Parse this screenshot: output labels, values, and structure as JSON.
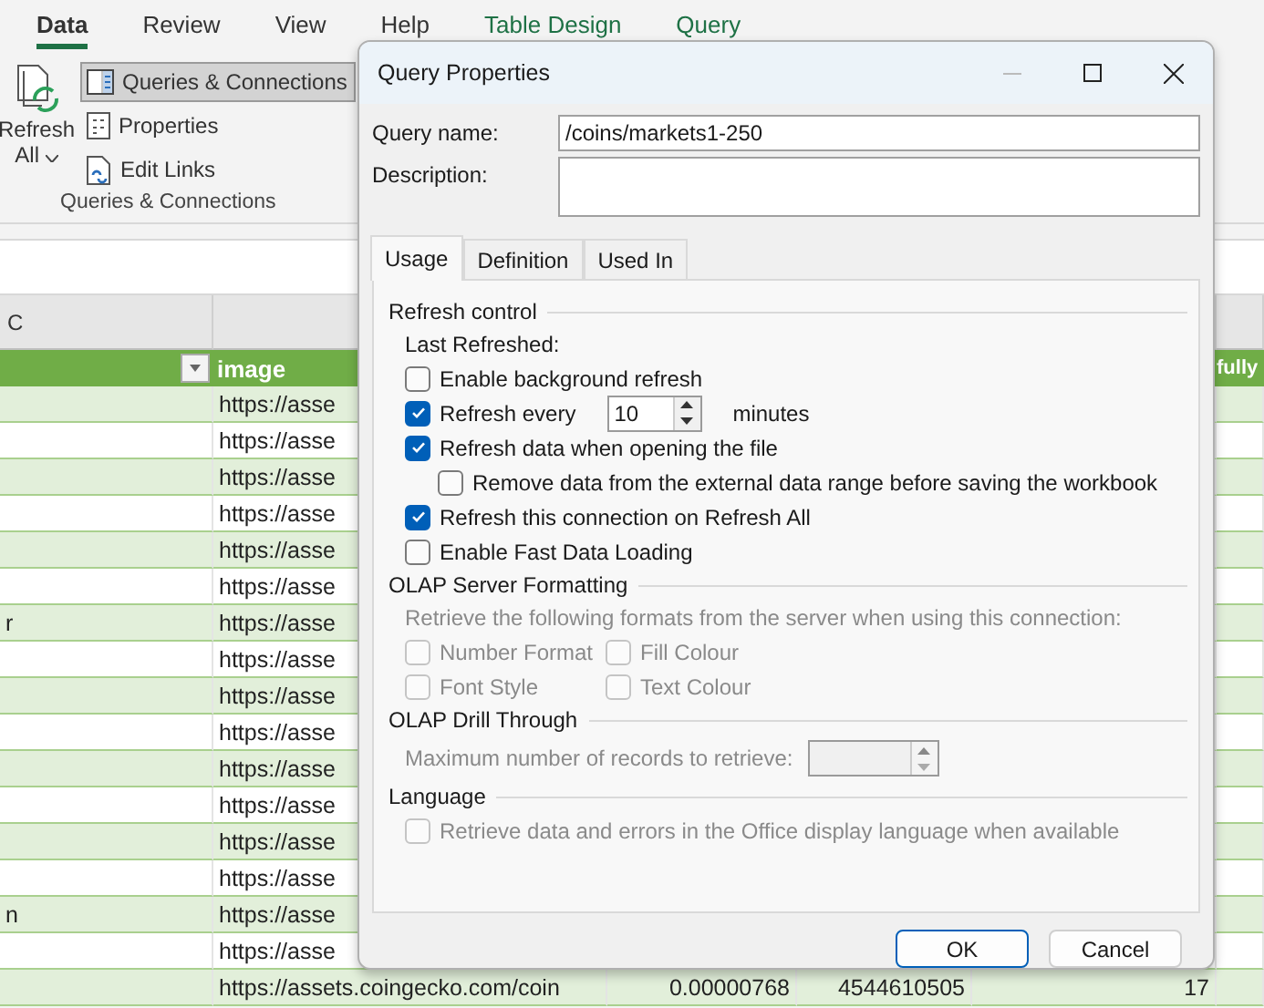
{
  "ribbon": {
    "tabs": [
      {
        "label": "Data",
        "selected": true,
        "contextual": false
      },
      {
        "label": "Review",
        "selected": false,
        "contextual": false
      },
      {
        "label": "View",
        "selected": false,
        "contextual": false
      },
      {
        "label": "Help",
        "selected": false,
        "contextual": false
      },
      {
        "label": "Table Design",
        "selected": false,
        "contextual": true
      },
      {
        "label": "Query",
        "selected": false,
        "contextual": true
      }
    ],
    "refresh_all": {
      "label": "Refresh",
      "caret_label": "All"
    },
    "commands": [
      {
        "label": "Queries & Connections",
        "selected": true
      },
      {
        "label": "Properties",
        "selected": false
      },
      {
        "label": "Edit Links",
        "selected": false
      }
    ],
    "group_label": "Queries & Connections"
  },
  "sheet": {
    "column_letters": {
      "column_1": "C"
    },
    "headers": {
      "column_2": "image",
      "column_6": "fully"
    },
    "rows": [
      {
        "image": "https://asse"
      },
      {
        "image": "https://asse"
      },
      {
        "image": "https://asse"
      },
      {
        "image": "https://asse"
      },
      {
        "image": "https://asse"
      },
      {
        "image": "https://asse"
      },
      {
        "column_1": "r",
        "image": "https://asse"
      },
      {
        "image": "https://asse"
      },
      {
        "image": "https://asse"
      },
      {
        "image": "https://asse"
      },
      {
        "image": "https://asse"
      },
      {
        "image": "https://asse"
      },
      {
        "image": "https://asse"
      },
      {
        "image": "https://asse"
      },
      {
        "column_1": "n",
        "image": "https://asse"
      },
      {
        "image": "https://asse"
      },
      {
        "image": "https://assets.coingecko.com/coin",
        "column_3": "0.00000768",
        "column_4": "4544610505",
        "column_5": "17"
      }
    ]
  },
  "dialog": {
    "title": "Query Properties",
    "query_name": {
      "label": "Query name:",
      "value": "/coins/markets1-250"
    },
    "description": {
      "label": "Description:"
    },
    "tabs": [
      {
        "label": "Usage",
        "selected": true
      },
      {
        "label": "Definition",
        "selected": false
      },
      {
        "label": "Used In",
        "selected": false
      }
    ],
    "refresh_control": {
      "title": "Refresh control",
      "last_refreshed": "Last Refreshed:",
      "options": [
        {
          "kind": "checkbox",
          "label": "Enable background refresh",
          "checked": false
        },
        {
          "kind": "interval",
          "label": "Refresh every",
          "checked": true,
          "value": "10",
          "unit": "minutes"
        },
        {
          "kind": "checkbox",
          "label": "Refresh data when opening the file",
          "checked": true
        },
        {
          "kind": "nested",
          "label": "Remove data from the external data range before saving the workbook",
          "checked": false
        },
        {
          "kind": "checkbox",
          "label": "Refresh this connection on Refresh All",
          "checked": true
        },
        {
          "kind": "checkbox",
          "label": "Enable Fast Data Loading",
          "checked": false
        }
      ]
    },
    "olap_formatting": {
      "title": "OLAP Server Formatting",
      "hint": "Retrieve the following formats from the server when using this connection:",
      "options": [
        {
          "label": "Number Format",
          "checked": false,
          "disabled": true
        },
        {
          "label": "Fill Colour",
          "checked": false,
          "disabled": true
        },
        {
          "label": "Font Style",
          "checked": false,
          "disabled": true
        },
        {
          "label": "Text Colour",
          "checked": false,
          "disabled": true
        }
      ]
    },
    "olap_drill": {
      "title": "OLAP Drill Through",
      "label": "Maximum number of records to retrieve:",
      "disabled": true
    },
    "language": {
      "title": "Language",
      "option": {
        "label": "Retrieve data and errors in the Office display language when available",
        "checked": false,
        "disabled": true
      }
    },
    "buttons": [
      {
        "label": "OK",
        "default": true
      },
      {
        "label": "Cancel",
        "default": false
      }
    ]
  }
}
